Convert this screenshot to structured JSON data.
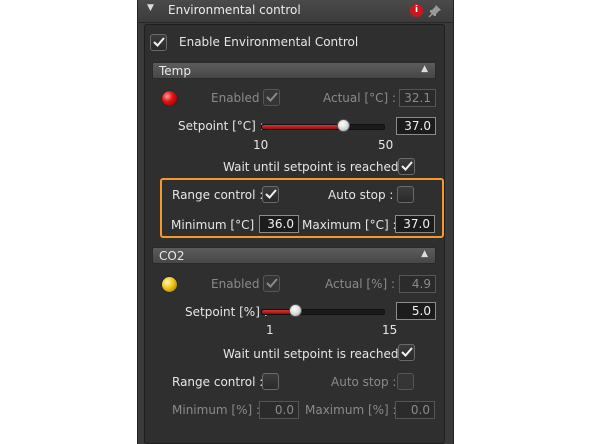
{
  "window": {
    "title": "Environmental control"
  },
  "enable": {
    "label": "Enable Environmental Control",
    "checked": true
  },
  "temp": {
    "header": "Temp",
    "enabled_label": "Enabled :",
    "enabled_checked": true,
    "actual_label": "Actual  [°C] :",
    "actual_value": "32.1",
    "setpoint_label": "Setpoint  [°C] :",
    "setpoint_value": "37.0",
    "slider_min": "10",
    "slider_max": "50",
    "slider_fraction": 0.675,
    "wait_label": "Wait until setpoint is reached :",
    "wait_checked": true,
    "range_label": "Range control :",
    "range_checked": true,
    "autostop_label": "Auto stop :",
    "autostop_checked": false,
    "minimum_label": "Minimum  [°C] :",
    "minimum_value": "36.0",
    "maximum_label": "Maximum  [°C] :",
    "maximum_value": "37.0",
    "led_color": "#e01212"
  },
  "co2": {
    "header": "CO2",
    "enabled_label": "Enabled :",
    "enabled_checked": true,
    "actual_label": "Actual  [%] :",
    "actual_value": "4.9",
    "setpoint_label": "Setpoint  [%] :",
    "setpoint_value": "5.0",
    "slider_min": "1",
    "slider_max": "15",
    "slider_fraction": 0.286,
    "wait_label": "Wait until setpoint is reached :",
    "wait_checked": true,
    "range_label": "Range control :",
    "range_checked": false,
    "autostop_label": "Auto stop :",
    "autostop_checked": false,
    "minimum_label": "Minimum  [%] :",
    "minimum_value": "0.0",
    "maximum_label": "Maximum  [%] :",
    "maximum_value": "0.0",
    "led_color": "#f2c418"
  },
  "colors": {
    "highlight": "#f29a2e",
    "panel": "#3a3a3a"
  }
}
